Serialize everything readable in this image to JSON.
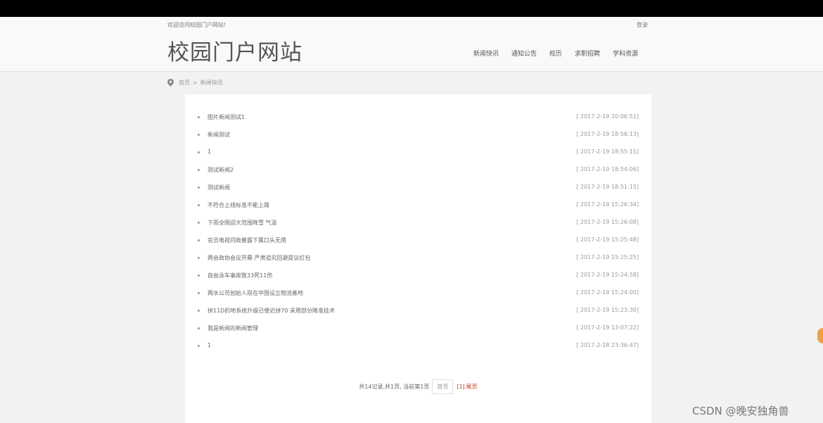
{
  "welcome_bar": {
    "text": "欢迎访问校园门户网站!",
    "login": "登录"
  },
  "header": {
    "site_title": "校园门户网站",
    "nav": [
      "新闻快讯",
      "通知公告",
      "校历",
      "求职招聘",
      "学科资源"
    ]
  },
  "breadcrumb": {
    "home": "首页",
    "separator": ">",
    "current": "新闻快讯"
  },
  "news": [
    {
      "title": "图片新闻测试1",
      "date": "[ 2017-2-19 20:06:51]"
    },
    {
      "title": "新闻测试",
      "date": "[ 2017-2-19 18:56:13]"
    },
    {
      "title": "1",
      "date": "[ 2017-2-19 18:55:11]"
    },
    {
      "title": "测试新闻2",
      "date": "[ 2017-2-19 18:54:06]"
    },
    {
      "title": "测试新闻",
      "date": "[ 2017-2-19 18:51:15]"
    },
    {
      "title": "不符合上线标准不能上路",
      "date": "[ 2017-2-19 15:26:34]"
    },
    {
      "title": "下雨全国迎大范围降雪 气温",
      "date": "[ 2017-2-19 15:26:08]"
    },
    {
      "title": "官员电视问政暴露下属口头无用",
      "date": "[ 2017-2-19 15:25:48]"
    },
    {
      "title": "两会政协会议开幕 严肃追究回避提议红包",
      "date": "[ 2017-2-19 15:25:25]"
    },
    {
      "title": "自由泳车事故致33死11伤",
      "date": "[ 2017-2-19 15:24:58]"
    },
    {
      "title": "两水公司创始人现在中国设立物流基地",
      "date": "[ 2017-2-19 15:24:00]"
    },
    {
      "title": "拼11D的地系统升级已使近拼70 采用部分降准技术",
      "date": "[ 2017-2-19 15:23:30]"
    },
    {
      "title": "我是新闻的新闻管理",
      "date": "[ 2017-2-19 13:07:22]"
    },
    {
      "title": "1",
      "date": "[ 2017-2-18 23:36:47]"
    }
  ],
  "pagination": {
    "summary": "共14记录,共1页, 当前第1页",
    "first": "首页",
    "current": "[1]",
    "last": "尾页"
  },
  "watermark": "CSDN @晚安独角兽"
}
